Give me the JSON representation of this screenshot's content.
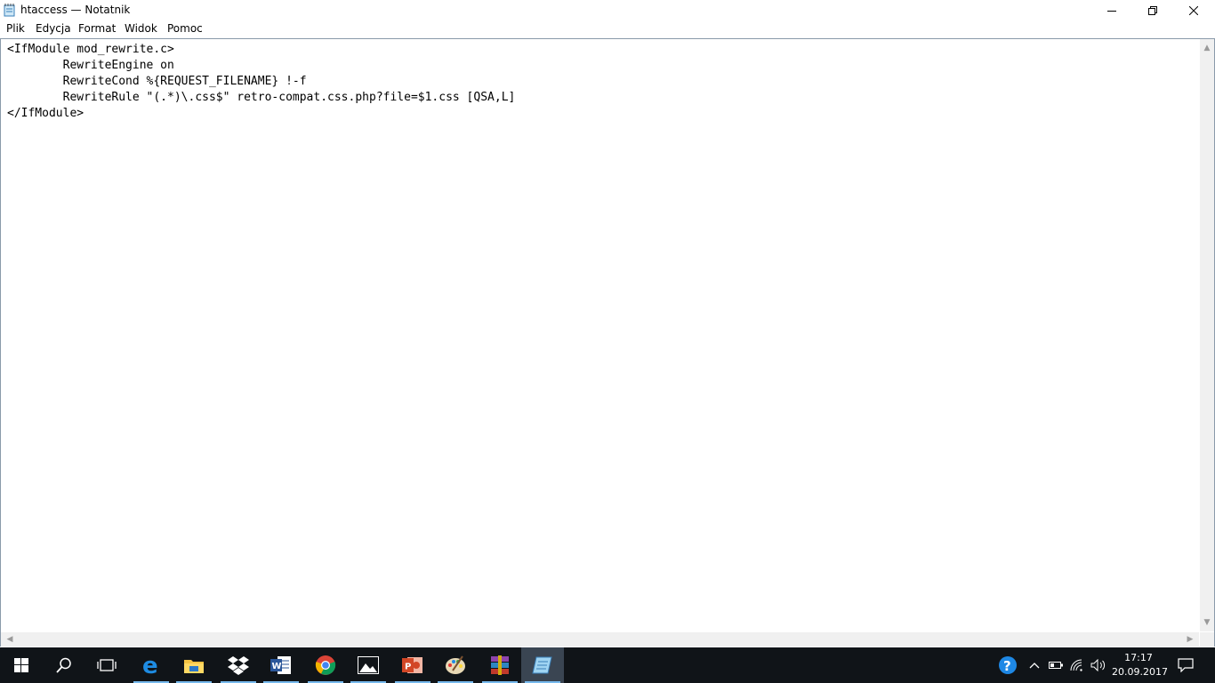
{
  "window": {
    "title": "htaccess — Notatnik",
    "icon": "notepad-icon"
  },
  "window_controls": {
    "minimize": "minimize-icon",
    "restore": "restore-icon",
    "close": "close-icon"
  },
  "menu": {
    "items": [
      {
        "label": "Plik"
      },
      {
        "label": "Edycja"
      },
      {
        "label": "Format"
      },
      {
        "label": "Widok"
      },
      {
        "label": "Pomoc"
      }
    ]
  },
  "editor": {
    "content": "<IfModule mod_rewrite.c>\n        RewriteEngine on\n        RewriteCond %{REQUEST_FILENAME} !-f\n        RewriteRule \"(.*)\\.css$\" retro-compat.css.php?file=$1.css [QSA,L]\n</IfModule>"
  },
  "taskbar": {
    "items": [
      {
        "name": "start-icon"
      },
      {
        "name": "search-icon"
      },
      {
        "name": "task-view-icon"
      },
      {
        "name": "edge-icon"
      },
      {
        "name": "file-explorer-icon"
      },
      {
        "name": "dropbox-icon"
      },
      {
        "name": "word-icon"
      },
      {
        "name": "chrome-icon"
      },
      {
        "name": "photos-icon"
      },
      {
        "name": "powerpoint-icon"
      },
      {
        "name": "paint-icon"
      },
      {
        "name": "winrar-icon"
      },
      {
        "name": "notepad-icon"
      }
    ],
    "tray": {
      "icons": [
        "help-icon",
        "chevron-up-icon",
        "battery-icon",
        "wifi-icon",
        "volume-icon"
      ],
      "time": "17:17",
      "date": "20.09.2017",
      "notification_icon": "action-center-icon"
    }
  },
  "colors": {
    "taskbar_bg": "#101418",
    "taskbar_active": "#3a4552",
    "running_indicator": "#76b9ed"
  }
}
